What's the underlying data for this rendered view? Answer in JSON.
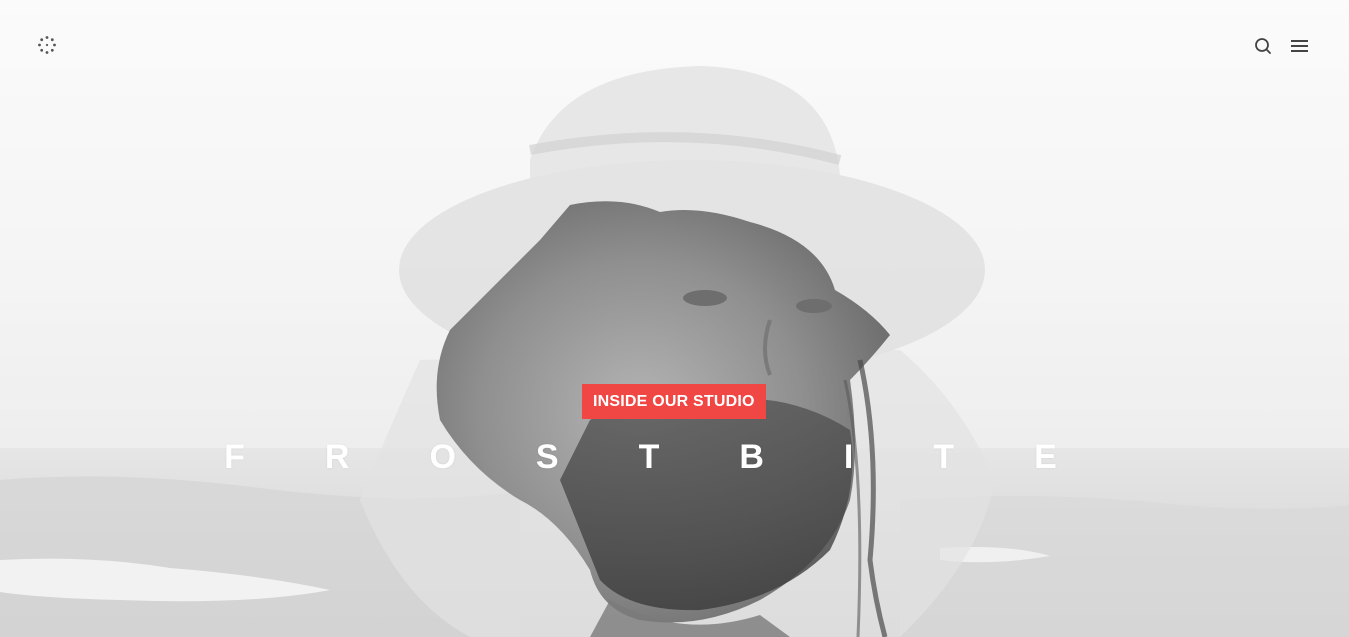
{
  "header": {
    "logo_icon": "dotted-circle-loader-icon",
    "search_icon": "search-icon",
    "menu_icon": "hamburger-menu-icon"
  },
  "hero": {
    "badge_label": "INSIDE OUR STUDIO",
    "title": "FROSTBITE",
    "badge_color": "#f14744",
    "title_color": "#ffffff"
  }
}
